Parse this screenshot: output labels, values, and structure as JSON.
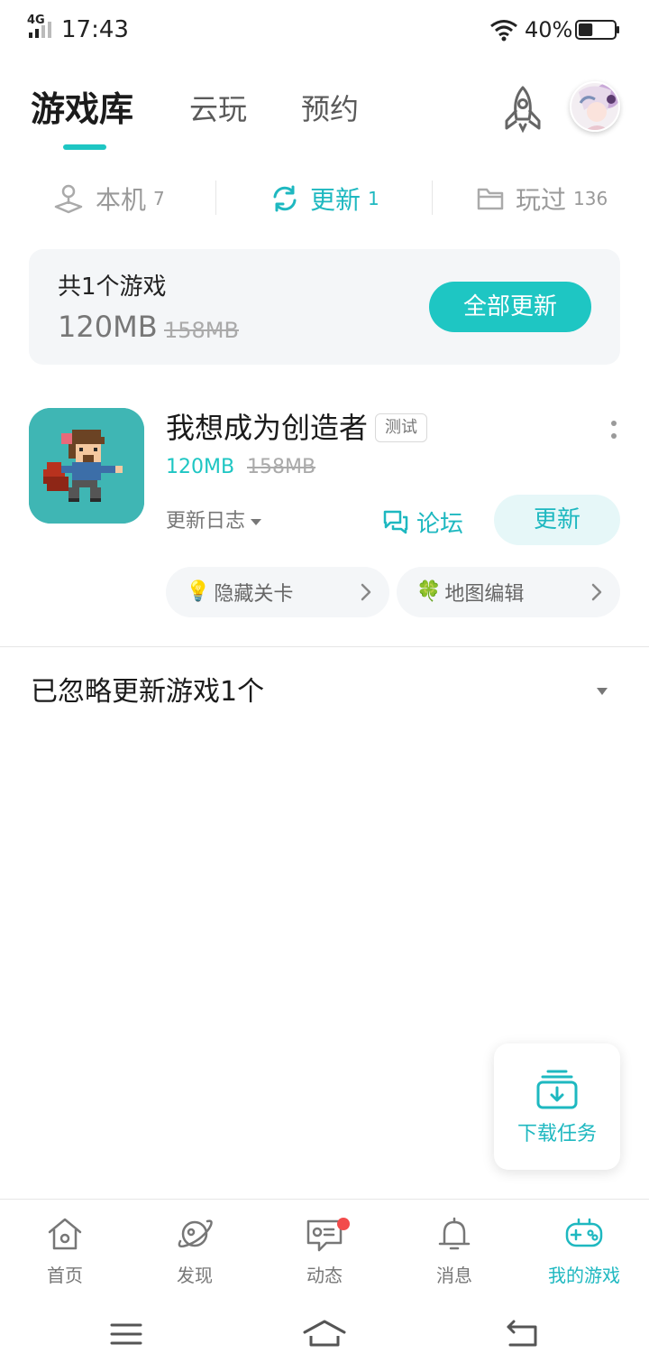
{
  "status_bar": {
    "network": "4G",
    "time": "17:43",
    "battery": "40%",
    "battery_level": 0.4
  },
  "header": {
    "tabs": [
      {
        "label": "游戏库",
        "active": true
      },
      {
        "label": "云玩",
        "active": false
      },
      {
        "label": "预约",
        "active": false
      }
    ],
    "rocket_icon": "rocket-icon",
    "avatar": "user-avatar"
  },
  "subtabs": [
    {
      "label": "本机",
      "count": "7",
      "icon": "device-icon"
    },
    {
      "label": "更新",
      "count": "1",
      "icon": "refresh-icon",
      "active": true
    },
    {
      "label": "玩过",
      "count": "136",
      "icon": "folder-icon"
    }
  ],
  "summary": {
    "title": "共1个游戏",
    "size": "120MB",
    "old_size": "158MB",
    "button": "全部更新"
  },
  "game": {
    "title": "我想成为创造者",
    "tag": "测试",
    "size": "120MB",
    "old_size": "158MB",
    "changelog": "更新日志",
    "forum": "论坛",
    "update": "更新",
    "chips": [
      {
        "emoji": "💡",
        "label": "隐藏关卡"
      },
      {
        "emoji": "🍀",
        "label": "地图编辑"
      }
    ]
  },
  "ignored": {
    "text": "已忽略更新游戏1个"
  },
  "download_task": {
    "label": "下载任务"
  },
  "bottom_nav": [
    {
      "label": "首页",
      "icon": "home-icon"
    },
    {
      "label": "发现",
      "icon": "planet-icon"
    },
    {
      "label": "动态",
      "icon": "chat-card-icon",
      "badge": true
    },
    {
      "label": "消息",
      "icon": "bell-icon"
    },
    {
      "label": "我的游戏",
      "icon": "gamepad-icon",
      "active": true
    }
  ],
  "colors": {
    "accent": "#1ec6c3",
    "accent_text": "#1eb8c0",
    "badge": "#f24b4b"
  }
}
